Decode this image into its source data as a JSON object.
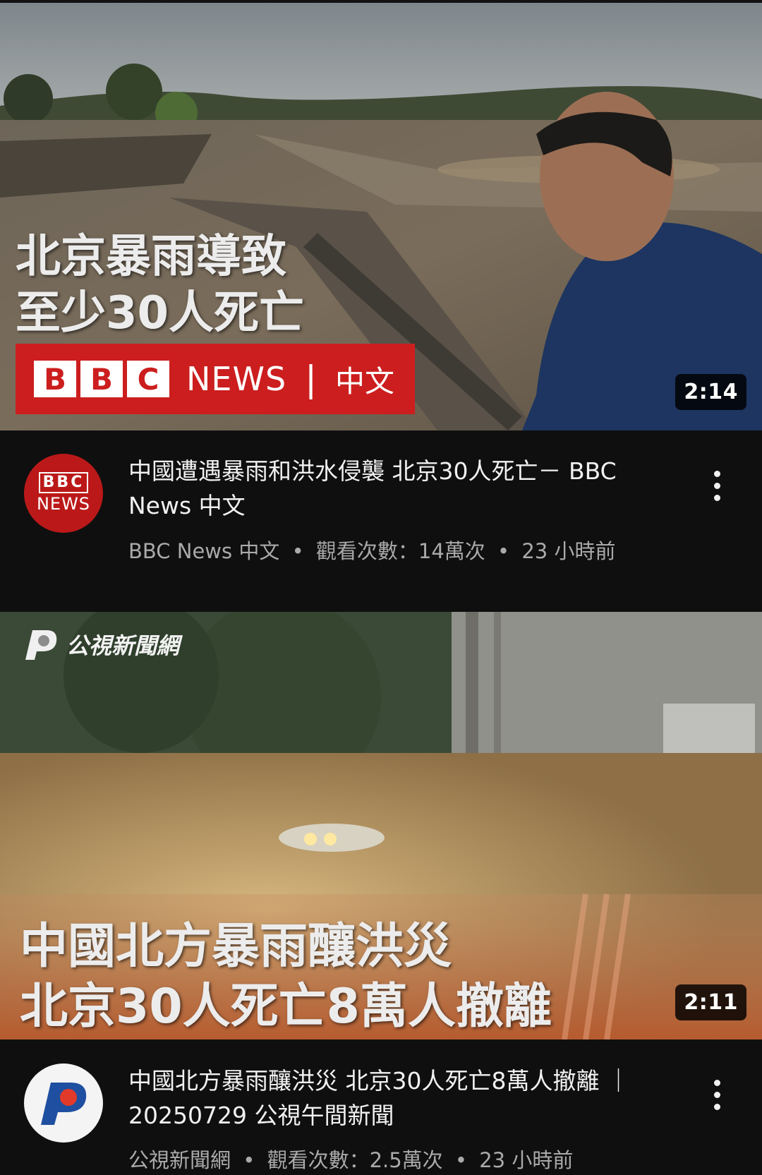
{
  "videos": [
    {
      "thumbnail": {
        "headline_line1": "北京暴雨導致",
        "headline_line2": "至少30人死亡",
        "brand_letters": [
          "B",
          "B",
          "C"
        ],
        "brand_news": "NEWS",
        "brand_separator": "|",
        "brand_lang": "中文"
      },
      "duration": "2:14",
      "avatar": {
        "line1": "BBC",
        "line2": "NEWS"
      },
      "title": "中國遭遇暴雨和洪水侵襲 北京30人死亡－ BBC News 中文",
      "channel": "BBC News 中文",
      "views": "觀看次數：14萬次",
      "age": "23 小時前",
      "separator": "•"
    },
    {
      "thumbnail": {
        "logo_text": "公視新聞網",
        "headline_line1": "中國北方暴雨釀洪災",
        "headline_line2": "北京30人死亡8萬人撤離"
      },
      "duration": "2:11",
      "title": "中國北方暴雨釀洪災 北京30人死亡8萬人撤離 ｜20250729 公視午間新聞",
      "channel": "公視新聞網",
      "views": "觀看次數：2.5萬次",
      "age": "23 小時前",
      "separator": "•"
    }
  ],
  "colors": {
    "background": "#0f0f0f",
    "bbc_red": "#cc1e1e",
    "meta_text": "#aaaaaa"
  }
}
